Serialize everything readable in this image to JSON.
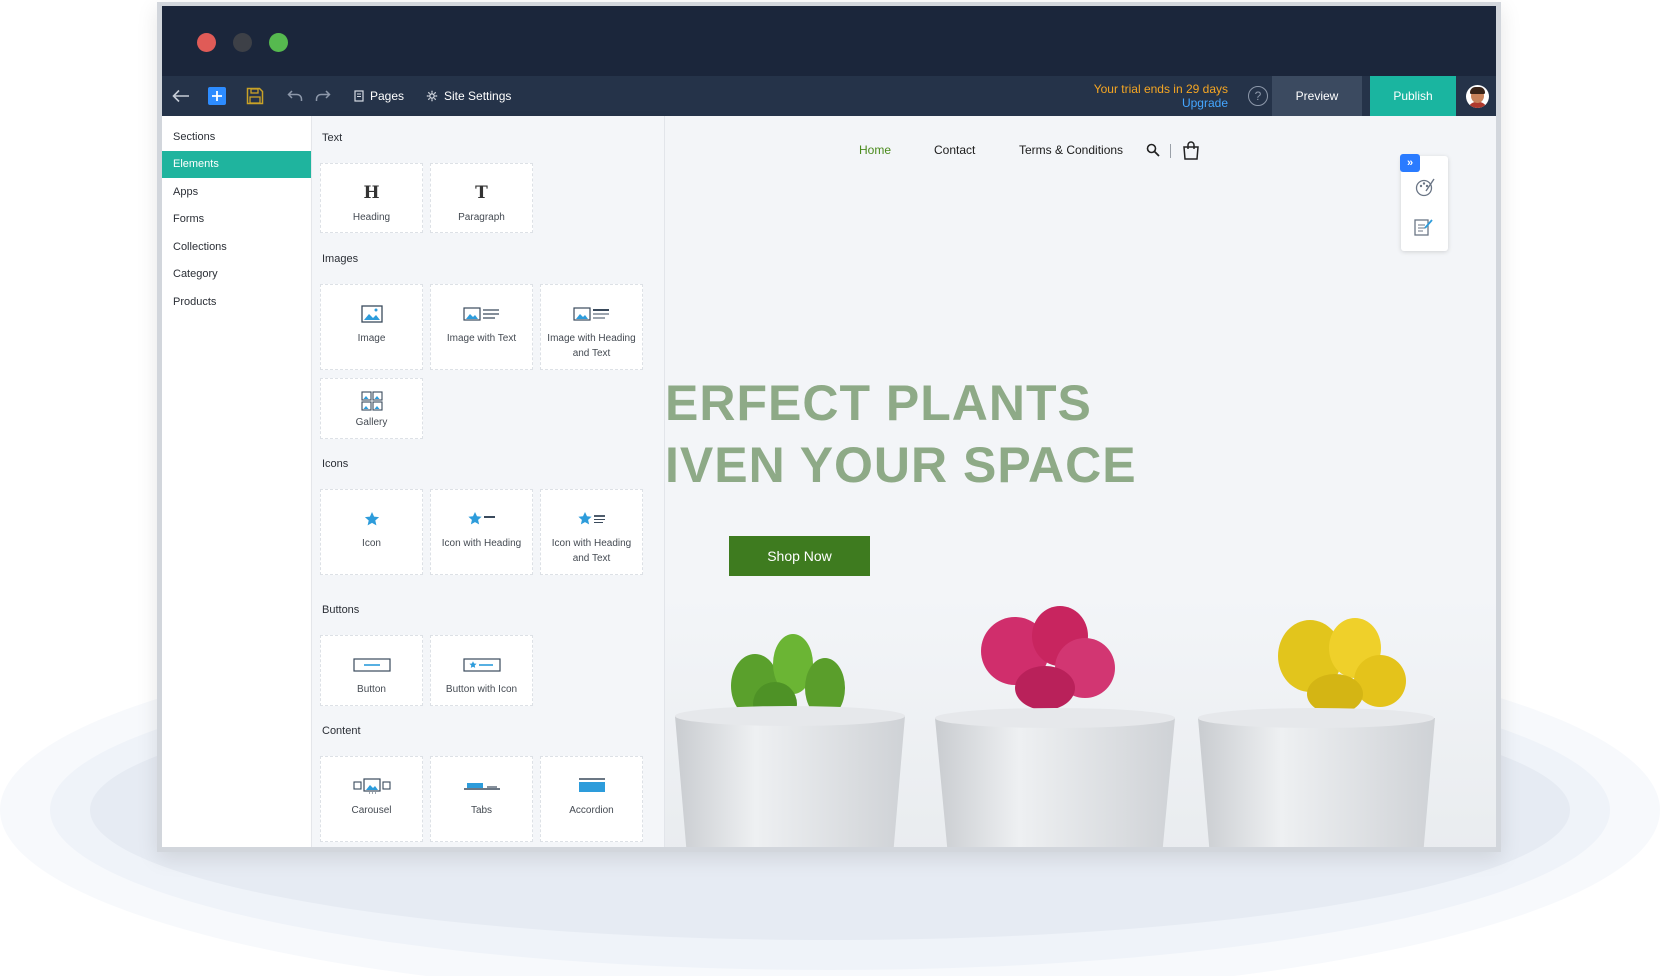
{
  "toolbar": {
    "pages_label": "Pages",
    "site_settings_label": "Site Settings",
    "trial_text": "Your trial ends in 29 days",
    "upgrade_label": "Upgrade",
    "preview_label": "Preview",
    "publish_label": "Publish"
  },
  "sidebar": {
    "items": [
      {
        "label": "Sections"
      },
      {
        "label": "Elements"
      },
      {
        "label": "Apps"
      },
      {
        "label": "Forms"
      },
      {
        "label": "Collections"
      },
      {
        "label": "Category"
      },
      {
        "label": "Products"
      }
    ],
    "active": "Elements"
  },
  "elements": {
    "text": {
      "title": "Text",
      "heading": "Heading",
      "paragraph": "Paragraph"
    },
    "images": {
      "title": "Images",
      "image": "Image",
      "image_with_text": "Image with Text",
      "image_with_heading_and_text": "Image with Heading and Text",
      "gallery": "Gallery"
    },
    "icons": {
      "title": "Icons",
      "icon": "Icon",
      "icon_with_heading": "Icon with Heading",
      "icon_with_heading_and_text": "Icon with Heading and Text"
    },
    "buttons": {
      "title": "Buttons",
      "button": "Button",
      "button_with_icon": "Button with Icon"
    },
    "content": {
      "title": "Content",
      "carousel": "Carousel",
      "tabs": "Tabs",
      "accordion": "Accordion"
    }
  },
  "site": {
    "nav": {
      "home": "Home",
      "contact": "Contact",
      "terms": "Terms & Conditions"
    },
    "hero_line1": "ERFECT PLANTS",
    "hero_line2": "IVEN YOUR SPACE",
    "shop_now": "Shop Now"
  },
  "colors": {
    "accent": "#1fb49e",
    "publish": "#1ab5a0",
    "titlebar": "#1b263b",
    "toolbar": "#253349",
    "trial": "#f5a623",
    "upgrade": "#45a6ff",
    "hero_text": "#8eaa87",
    "shop_button": "#3e7b1f",
    "nav_active": "#4a8a1c"
  }
}
